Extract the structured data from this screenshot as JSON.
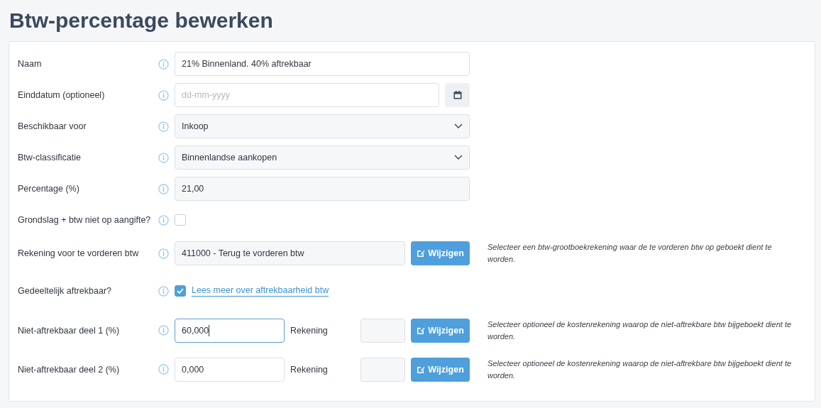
{
  "title": "Btw-percentage bewerken",
  "rows": [
    {
      "kind": "text",
      "label": "Naam",
      "value": "21% Binnenland. 40% aftrekbaar"
    },
    {
      "kind": "date",
      "label": "Einddatum (optioneel)",
      "placeholder": "dd-mm-yyyy"
    },
    {
      "kind": "select",
      "label": "Beschikbaar voor",
      "value": "Inkoop"
    },
    {
      "kind": "select",
      "label": "Btw-classificatie",
      "value": "Binnenlandse aankopen"
    },
    {
      "kind": "readonly",
      "label": "Percentage (%)",
      "value": "21,00"
    },
    {
      "kind": "checkbox",
      "label": "Grondslag + btw niet op aangifte?",
      "checked": false
    },
    {
      "kind": "account",
      "label": "Rekening voor te vorderen btw",
      "value": "411000 - Terug te vorderen btw",
      "button": "Wijzigen",
      "help": "Selecteer een btw-grootboekrekening waar de te vorderen btw op geboekt dient te worden."
    },
    {
      "kind": "checkbox",
      "label": "Gedeeltelijk aftrekbaar?",
      "checked": true,
      "link": "Lees meer over aftrekbaarheid btw"
    },
    {
      "kind": "split",
      "label": "Niet-aftrekbaar deel 1 (%)",
      "value": "60,000",
      "focused": true,
      "account_label": "Rekening",
      "button": "Wijzigen",
      "help": "Selecteer optioneel de kostenrekening waarop de niet-aftrekbare btw bijgeboekt dient te worden."
    },
    {
      "kind": "split",
      "label": "Niet-aftrekbaar deel 2 (%)",
      "value": "0,000",
      "focused": false,
      "account_label": "Rekening",
      "button": "Wijzigen",
      "help": "Selecteer optioneel de kostenrekening waarop de niet-aftrekbare btw bijgeboekt dient te worden."
    }
  ]
}
